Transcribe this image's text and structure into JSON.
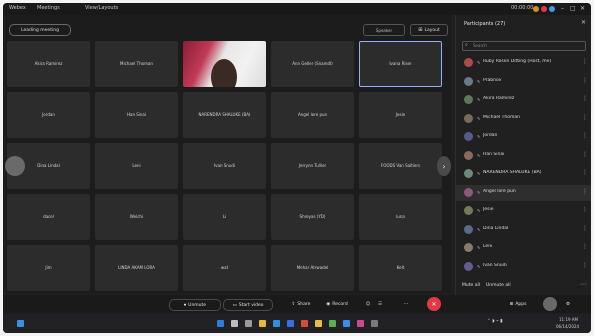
{
  "titlebar": {
    "menu_1": "Webex",
    "menu_2": "Meetings",
    "menu_3": "View/Layouts",
    "time": "00:00:00"
  },
  "meeting": {
    "info_button": "Leading meeting",
    "layout_button": "Layout",
    "speaker_view_label": "Speaker"
  },
  "grid": {
    "tiles": [
      "Akira Ramirez",
      "Michael Thoman",
      "",
      "Ann Geller (Snamdl)",
      "Ivana Riser",
      "Jordan",
      "Han Sinai",
      "NARENDRA SHALUKE (BA)",
      "Angel lore pun",
      "Jesie",
      "Dina Lindal",
      "Leni",
      "Ivan Snudi",
      "Jerrynn Tullier",
      "FOODS Van Saltiers",
      "dacel",
      "Welchi",
      "Li",
      "Shreyas (YD)",
      "luna",
      "Jim",
      "LINDA AKAM LORA",
      "wat",
      "Mehar Atrwadel",
      "Kelt"
    ],
    "active_index": 4,
    "video_index": 2
  },
  "panel": {
    "title": "Participants (27)",
    "search_placeholder": "Search",
    "participants": [
      {
        "name": "Ruby Rosen Ditting (Host, me)",
        "avatar_color": "#b04a4a"
      },
      {
        "name": "Prabnov",
        "avatar_color": "#6a7a8a"
      },
      {
        "name": "Akira Ramirez",
        "avatar_color": "#5a7a5a"
      },
      {
        "name": "Michael Thoman",
        "avatar_color": "#7a6a5a"
      },
      {
        "name": "Jordan",
        "avatar_color": "#5a5a8a"
      },
      {
        "name": "Han Sinai",
        "avatar_color": "#8a6a5a"
      },
      {
        "name": "NARENDRA SHALUKE (BA)",
        "avatar_color": "#6a8a7a"
      },
      {
        "name": "Angel lore pun",
        "avatar_color": "#8a5a7a"
      },
      {
        "name": "Jesie",
        "avatar_color": "#7a7a5a"
      },
      {
        "name": "Dina Lindal",
        "avatar_color": "#5a6a8a"
      },
      {
        "name": "Leni",
        "avatar_color": "#8a7a6a"
      },
      {
        "name": "Ivan Snudi",
        "avatar_color": "#6a5a8a"
      }
    ],
    "mute_all": "Mute all",
    "unmute_all": "Unmute all"
  },
  "toolbar": {
    "mute": "Unmute",
    "video": "Start video",
    "share": "Share",
    "record": "Record",
    "apps": "Apps",
    "leave_color": "#e23a44"
  },
  "taskbar": {
    "time": "11:19 AM",
    "date": "06/14/2024"
  },
  "colors": {
    "accent": "#8ab4f8",
    "leave": "#e23a44"
  }
}
